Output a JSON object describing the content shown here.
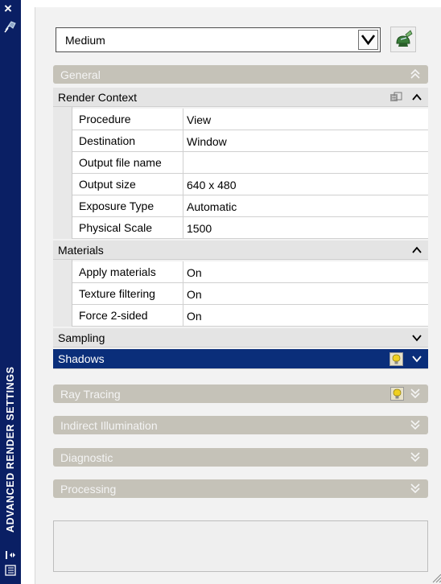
{
  "window": {
    "title": "ADVANCED RENDER SETTINGS",
    "close_glyph": "×"
  },
  "preset": {
    "value": "Medium"
  },
  "sections": {
    "general": {
      "label": "General"
    },
    "render_context": {
      "label": "Render Context",
      "rows": [
        {
          "key": "Procedure",
          "value": "View"
        },
        {
          "key": "Destination",
          "value": "Window"
        },
        {
          "key": "Output file name",
          "value": ""
        },
        {
          "key": "Output size",
          "value": "640 x 480"
        },
        {
          "key": "Exposure Type",
          "value": "Automatic"
        },
        {
          "key": "Physical Scale",
          "value": "1500"
        }
      ]
    },
    "materials": {
      "label": "Materials",
      "rows": [
        {
          "key": "Apply materials",
          "value": "On"
        },
        {
          "key": "Texture filtering",
          "value": "On"
        },
        {
          "key": "Force 2-sided",
          "value": "On"
        }
      ]
    },
    "sampling": {
      "label": "Sampling"
    },
    "shadows": {
      "label": "Shadows"
    },
    "ray_tracing": {
      "label": "Ray Tracing"
    },
    "indirect_illumination": {
      "label": "Indirect Illumination"
    },
    "diagnostic": {
      "label": "Diagnostic"
    },
    "processing": {
      "label": "Processing"
    }
  },
  "colors": {
    "title_strip": "#0a1f64",
    "active_header": "#0a2e7a",
    "group_header": "#c5c2b8",
    "bulb": "#f0d020"
  },
  "icons": [
    "close-icon",
    "pin-icon",
    "render-teapot-icon",
    "dropdown-arrow-icon",
    "chevron-up-icon",
    "chevron-down-icon",
    "double-chevron-up-icon",
    "double-chevron-down-icon",
    "lightbulb-icon",
    "render-context-icon",
    "properties-icon",
    "auto-hide-icon"
  ]
}
